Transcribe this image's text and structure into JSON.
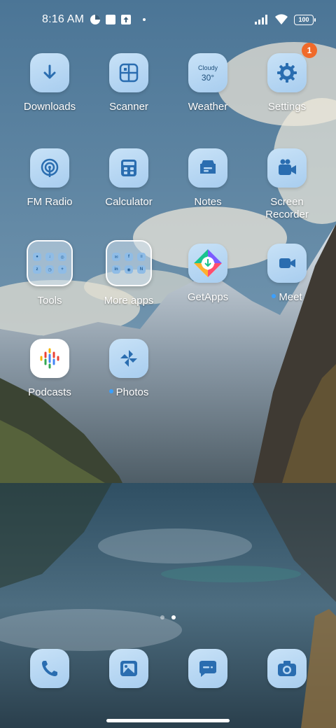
{
  "status_bar": {
    "time": "8:16 AM",
    "battery": "100",
    "icons": [
      "vpn-key-icon",
      "notification-square-icon",
      "upload-arrow-icon",
      "dot-icon",
      "signal-icon",
      "wifi-icon",
      "battery-icon"
    ]
  },
  "apps": [
    {
      "label": "Downloads",
      "icon": "download-arrow-icon"
    },
    {
      "label": "Scanner",
      "icon": "scanner-frame-icon"
    },
    {
      "label": "Weather",
      "icon": "weather-widget-icon",
      "weather_condition": "Cloudy",
      "weather_temp": "30°"
    },
    {
      "label": "Settings",
      "icon": "gear-icon",
      "badge": "1"
    },
    {
      "label": "FM Radio",
      "icon": "radio-broadcast-icon"
    },
    {
      "label": "Calculator",
      "icon": "calculator-icon"
    },
    {
      "label": "Notes",
      "icon": "notes-icon"
    },
    {
      "label": "Screen Recorder",
      "icon": "video-camera-icon"
    },
    {
      "label": "Tools",
      "icon": "folder-icon"
    },
    {
      "label": "More apps",
      "icon": "folder-icon"
    },
    {
      "label": "GetApps",
      "icon": "getapps-icon"
    },
    {
      "label": "Meet",
      "icon": "video-call-icon"
    },
    {
      "label": "Podcasts",
      "icon": "podcasts-icon"
    },
    {
      "label": "Photos",
      "icon": "pinwheel-icon"
    }
  ],
  "dock": [
    {
      "name": "phone",
      "icon": "phone-icon"
    },
    {
      "name": "gallery",
      "icon": "gallery-icon"
    },
    {
      "name": "messages",
      "icon": "message-bubble-icon"
    },
    {
      "name": "camera",
      "icon": "camera-icon"
    }
  ],
  "page_indicator": {
    "count": 2,
    "active": 2
  },
  "colors": {
    "icon_bg": "#b7d7f3",
    "icon_glyph": "#2a6db0",
    "badge": "#f06a2a",
    "new_dot": "#3aa0ff"
  }
}
